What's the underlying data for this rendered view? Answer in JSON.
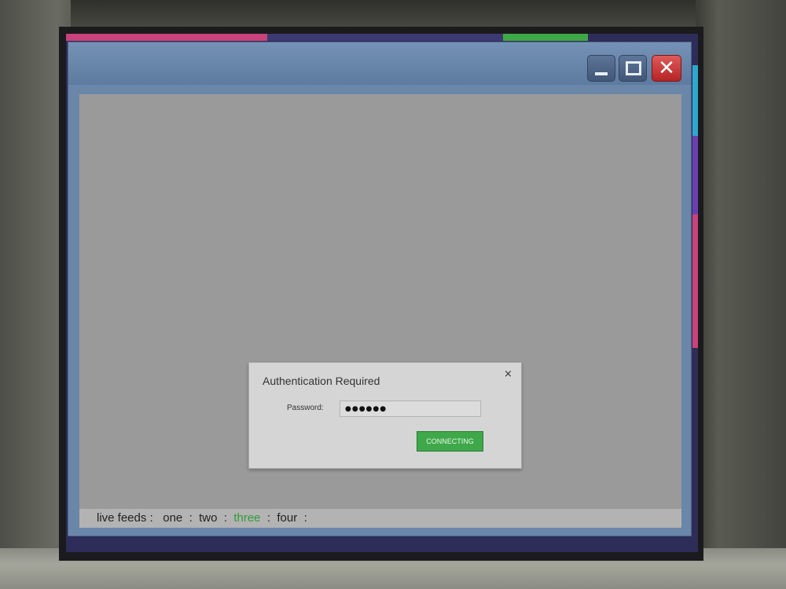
{
  "colors": {
    "accent_pink": "#d64e8a",
    "accent_green": "#3ea845",
    "accent_blue": "#2fa7cf",
    "accent_purple": "#6c3fb0",
    "window_frame": "#6a86a9",
    "screen_bg": "#2e2c58",
    "active_feed": "#2e9c35"
  },
  "window": {
    "controls": {
      "minimize": "minimize-icon",
      "maximize": "maximize-icon",
      "close": "close-icon"
    }
  },
  "dialog": {
    "title": "Authentication Required",
    "close_glyph": "×",
    "password_label": "Password:",
    "password_value": "●●●●●●",
    "connect_label": "CONNECTING"
  },
  "status_bar": {
    "prefix": "live feeds :",
    "feeds": [
      "one",
      "two",
      "three",
      "four"
    ],
    "active_feed": "three",
    "separator": ":"
  }
}
